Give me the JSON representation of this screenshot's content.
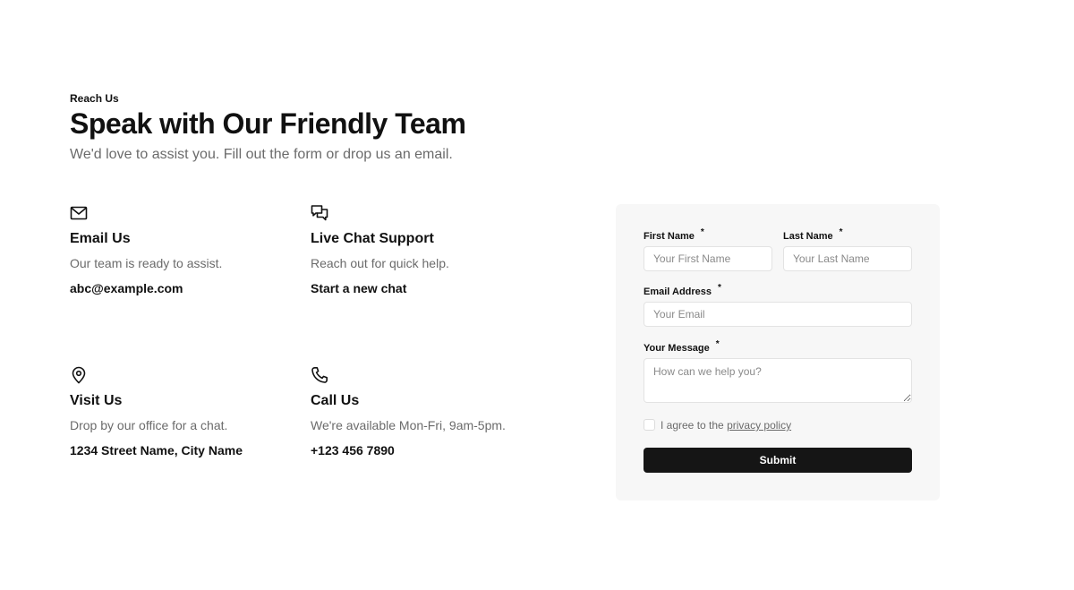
{
  "header": {
    "eyebrow": "Reach Us",
    "title": "Speak with Our Friendly Team",
    "subtitle": "We'd love to assist you. Fill out the form or drop us an email."
  },
  "contacts": [
    {
      "icon": "mail-icon",
      "title": "Email Us",
      "description": "Our team is ready to assist.",
      "link": "abc@example.com"
    },
    {
      "icon": "chat-icon",
      "title": "Live Chat Support",
      "description": "Reach out for quick help.",
      "link": "Start a new chat"
    },
    {
      "icon": "map-pin-icon",
      "title": "Visit Us",
      "description": "Drop by our office for a chat.",
      "link": "1234 Street Name, City Name"
    },
    {
      "icon": "phone-icon",
      "title": "Call Us",
      "description": "We're available Mon-Fri, 9am-5pm.",
      "link": "+123 456 7890"
    }
  ],
  "form": {
    "first_name": {
      "label": "First Name",
      "required_mark": "*",
      "placeholder": "Your First Name",
      "value": ""
    },
    "last_name": {
      "label": "Last Name",
      "required_mark": "*",
      "placeholder": "Your Last Name",
      "value": ""
    },
    "email": {
      "label": "Email Address",
      "required_mark": "*",
      "placeholder": "Your Email",
      "value": ""
    },
    "message": {
      "label": "Your Message",
      "required_mark": "*",
      "placeholder": "How can we help you?",
      "value": ""
    },
    "agree_prefix": "I agree to the ",
    "agree_link": "privacy policy",
    "agree_checked": false,
    "submit_label": "Submit"
  },
  "colors": {
    "text_primary": "#111111",
    "text_muted": "#6b6b6b",
    "panel_background": "#f7f7f7",
    "button_background": "#151515",
    "button_text": "#ffffff"
  }
}
